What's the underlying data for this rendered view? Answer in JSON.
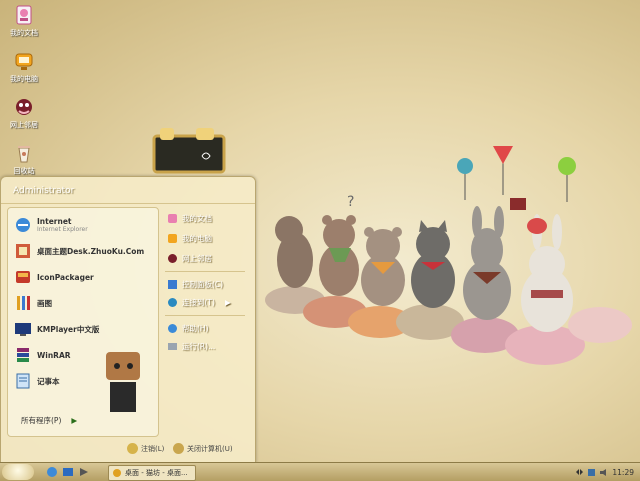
{
  "desktop": {
    "icons": [
      {
        "label": "我的文档",
        "icon": "my-documents-icon"
      },
      {
        "label": "我的电脑",
        "icon": "my-computer-icon"
      },
      {
        "label": "网上邻居",
        "icon": "network-places-icon"
      },
      {
        "label": "回收站",
        "icon": "recycle-bin-icon"
      }
    ]
  },
  "start_menu": {
    "user": "Administrator",
    "programs": [
      {
        "label": "Internet",
        "sub": "Internet Explorer",
        "icon": "internet-explorer-icon"
      },
      {
        "label": "桌面主题Desk.ZhuoKu.Com",
        "sub": "",
        "icon": "theme-icon"
      },
      {
        "label": "IconPackager",
        "sub": "",
        "icon": "iconpackager-icon"
      },
      {
        "label": "画图",
        "sub": "",
        "icon": "paint-icon"
      },
      {
        "label": "KMPlayer中文版",
        "sub": "",
        "icon": "kmplayer-icon"
      },
      {
        "label": "WinRAR",
        "sub": "",
        "icon": "winrar-icon"
      },
      {
        "label": "记事本",
        "sub": "",
        "icon": "notepad-icon"
      }
    ],
    "all_programs": "所有程序(P)",
    "places": [
      {
        "label": "我的文档",
        "icon": "my-documents-icon"
      },
      {
        "label": "我的电脑",
        "icon": "my-computer-icon"
      },
      {
        "label": "网上邻居",
        "icon": "network-places-icon"
      }
    ],
    "settings": [
      {
        "label": "控制面板(C)",
        "icon": "control-panel-icon"
      },
      {
        "label": "连接到(T)",
        "icon": "connect-to-icon"
      }
    ],
    "tools": [
      {
        "label": "帮助(H)",
        "icon": "help-icon"
      },
      {
        "label": "运行(R)...",
        "icon": "run-icon"
      }
    ],
    "logoff": "注销(L)",
    "shutdown": "关闭计算机(U)"
  },
  "taskbar": {
    "task_label": "桌面 - 猫坊 - 桌面...",
    "clock": "11:29"
  },
  "colors": {
    "wallpaper": "#e6d6a9",
    "taskbar": "#c7b47c",
    "menu": "#f6ecc8"
  }
}
